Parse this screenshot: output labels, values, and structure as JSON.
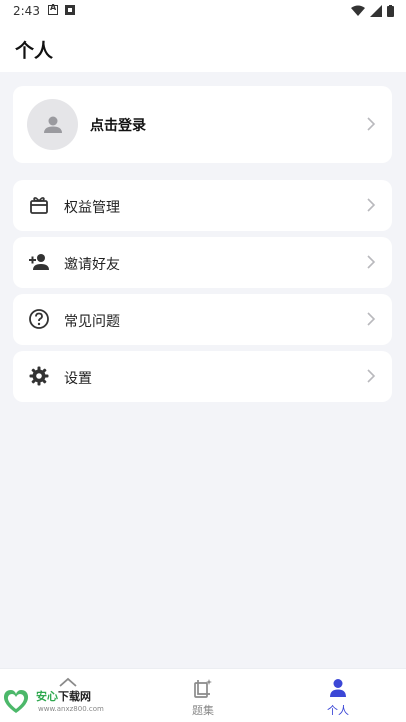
{
  "status_bar": {
    "time": "2:43"
  },
  "header": {
    "title": "个人"
  },
  "login": {
    "label": "点击登录"
  },
  "menu": [
    {
      "label": "权益管理",
      "icon": "gift-icon"
    },
    {
      "label": "邀请好友",
      "icon": "add-person-icon"
    },
    {
      "label": "常见问题",
      "icon": "question-icon"
    },
    {
      "label": "设置",
      "icon": "gear-icon"
    }
  ],
  "tabs": [
    {
      "label": "",
      "icon": "home-icon",
      "active": false
    },
    {
      "label": "题集",
      "icon": "question-set-icon",
      "active": false
    },
    {
      "label": "个人",
      "icon": "person-icon",
      "active": true
    }
  ],
  "watermark": {
    "name_a": "安心",
    "name_b": "下载网",
    "url": "www.anxz800.com"
  },
  "colors": {
    "accent": "#3b47d6",
    "background": "#f3f4f8",
    "card": "#ffffff"
  }
}
